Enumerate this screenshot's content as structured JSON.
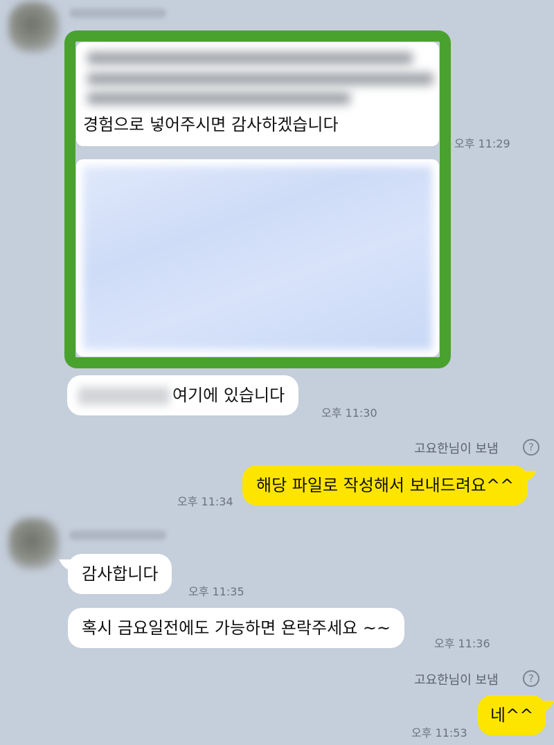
{
  "chat": {
    "messages": [
      {
        "type": "card",
        "caption": "경험으로 넣어주시면 감사하겠습니다",
        "time": "오후 11:29"
      },
      {
        "type": "text",
        "text": "여기에 있습니다",
        "time": "오후 11:30"
      },
      {
        "type": "sent_note",
        "note": "고요한님이 보냄"
      },
      {
        "type": "out",
        "text": "해당 파일로 작성해서 보내드려요^^",
        "time": "오후 11:34"
      },
      {
        "type": "text",
        "text": "감사합니다",
        "time": "오후 11:35"
      },
      {
        "type": "text",
        "text": "혹시 금요일전에도 가능하면 욘락주세요 ~~",
        "time": "오후 11:36"
      },
      {
        "type": "sent_note",
        "note": "고요한님이 보냄"
      },
      {
        "type": "out",
        "text": "네^^",
        "time": "오후 11:53"
      }
    ]
  },
  "icons": {
    "help": "?"
  },
  "colors": {
    "background": "#c5cedb",
    "incoming_bubble": "#ffffff",
    "outgoing_bubble": "#fee500",
    "highlight": "#4aa22e"
  }
}
